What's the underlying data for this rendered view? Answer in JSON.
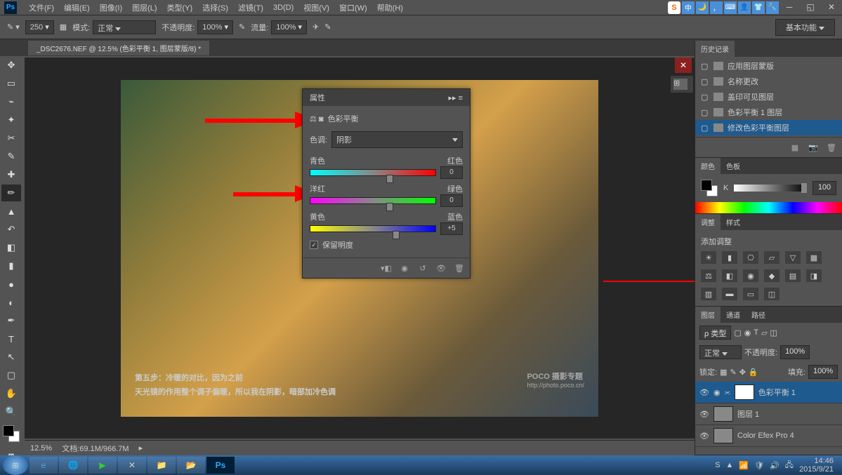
{
  "menubar": {
    "items": [
      "文件(F)",
      "编辑(E)",
      "图像(I)",
      "图层(L)",
      "类型(Y)",
      "选择(S)",
      "滤镜(T)",
      "3D(D)",
      "视图(V)",
      "窗口(W)",
      "帮助(H)"
    ],
    "input_mode": "中"
  },
  "optbar": {
    "brush_size": "250",
    "mode_label": "模式:",
    "mode_value": "正常",
    "opacity_label": "不透明度:",
    "opacity_value": "100%",
    "flow_label": "流量:",
    "flow_value": "100%",
    "essentials": "基本功能"
  },
  "tab": {
    "title": "_DSC2676.NEF @ 12.5% (色彩平衡 1, 图层蒙版/8) *"
  },
  "properties": {
    "tab": "属性",
    "title": "色彩平衡",
    "tone_label": "色调:",
    "tone_value": "阴影",
    "sliders": [
      {
        "left": "青色",
        "right": "红色",
        "value": "0",
        "grad": "grad-cr",
        "pos": 50
      },
      {
        "left": "洋红",
        "right": "绿色",
        "value": "0",
        "grad": "grad-mg",
        "pos": 50
      },
      {
        "left": "黄色",
        "right": "蓝色",
        "value": "+5",
        "grad": "grad-yb",
        "pos": 54
      }
    ],
    "preserve": "保留明度",
    "preserve_checked": true
  },
  "history": {
    "title": "历史记录",
    "items": [
      "应用图层蒙版",
      "名称更改",
      "盖印可见图层",
      "色彩平衡 1 图层",
      "修改色彩平衡图层"
    ],
    "selected": 4
  },
  "color": {
    "tabs": [
      "颜色",
      "色板"
    ],
    "k_label": "K",
    "k_value": "100"
  },
  "adjust": {
    "tabs": [
      "调整",
      "样式"
    ],
    "title": "添加调整"
  },
  "layers": {
    "tabs": [
      "图层",
      "通道",
      "路径"
    ],
    "kind": "ρ 类型",
    "blend": "正常",
    "opacity_label": "不透明度:",
    "opacity": "100%",
    "lock_label": "锁定:",
    "fill_label": "填充:",
    "fill": "100%",
    "items": [
      {
        "name": "色彩平衡 1",
        "sel": true,
        "adj": true
      },
      {
        "name": "图层 1",
        "sel": false,
        "adj": false
      },
      {
        "name": "Color Efex Pro 4",
        "sel": false,
        "adj": false
      }
    ]
  },
  "status": {
    "zoom": "12.5%",
    "doc": "文档:69.1M/966.7M"
  },
  "caption": {
    "line1": "第五步：冷暖的对比，因为之前",
    "line2": "天光镜的作用整个调子偏暖，所以我在阴影，暗部加冷色调"
  },
  "watermark": {
    "brand": "POCO 摄影专题",
    "url": "http://photo.poco.cn/"
  },
  "tray": {
    "time": "14:46",
    "date": "2015/9/21"
  }
}
